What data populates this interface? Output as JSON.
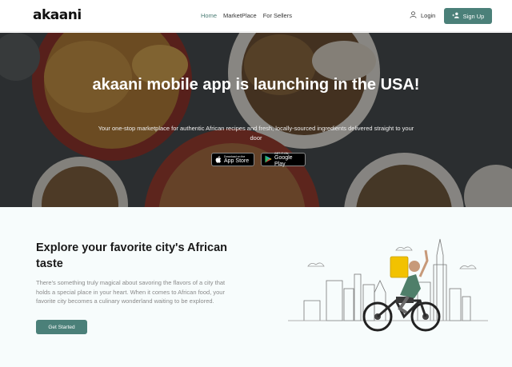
{
  "brand": {
    "logo_text": "akaani"
  },
  "nav": {
    "items": [
      {
        "label": "Home",
        "active": true
      },
      {
        "label": "MarketPlace",
        "active": false
      },
      {
        "label": "For Sellers",
        "active": false
      }
    ]
  },
  "auth": {
    "login_label": "Login",
    "signup_label": "Sign Up"
  },
  "hero": {
    "title": "akaani mobile app is launching in the USA!",
    "subtitle": "Your one-stop marketplace for authentic African recipes and fresh, locally-sourced ingredients delivered straight to your door",
    "app_store": {
      "small": "Download on the",
      "big": "App Store"
    },
    "google_play": {
      "small": "GET IT ON",
      "big": "Google Play"
    }
  },
  "explore": {
    "title": "Explore your favorite city's African taste",
    "text": "There's something truly magical about savoring the flavors of a city that holds a special place in your heart. When it comes to African food, your favorite city becomes a culinary wonderland waiting to be explored.",
    "cta_label": "Get Started"
  },
  "colors": {
    "accent": "#4b8079",
    "nav_active": "#4a7c74",
    "hero_overlay": "#2d2f31"
  },
  "icons": [
    "user-icon",
    "add-user-icon",
    "apple-icon",
    "google-play-icon"
  ]
}
